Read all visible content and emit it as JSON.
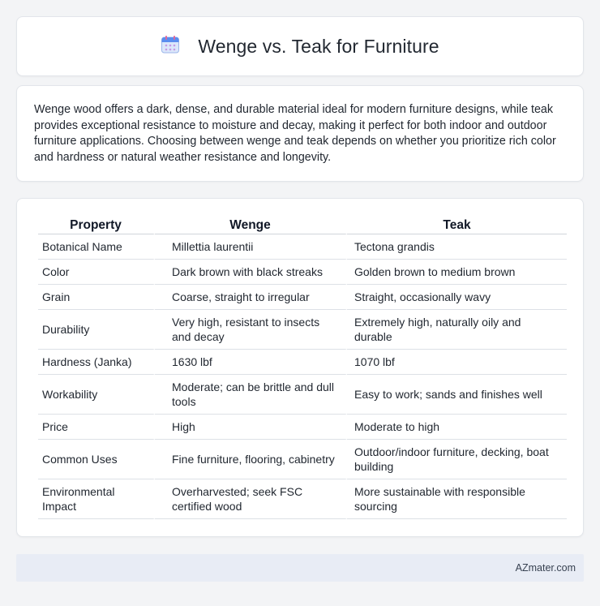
{
  "header": {
    "title": "Wenge vs. Teak for Furniture",
    "icon": "calendar-icon"
  },
  "intro": {
    "text": "Wenge wood offers a dark, dense, and durable material ideal for modern furniture designs, while teak provides exceptional resistance to moisture and decay, making it perfect for both indoor and outdoor furniture applications. Choosing between wenge and teak depends on whether you prioritize rich color and hardness or natural weather resistance and longevity."
  },
  "table": {
    "columns": [
      "Property",
      "Wenge",
      "Teak"
    ],
    "rows": [
      [
        "Botanical Name",
        "Millettia laurentii",
        "Tectona grandis"
      ],
      [
        "Color",
        "Dark brown with black streaks",
        "Golden brown to medium brown"
      ],
      [
        "Grain",
        "Coarse, straight to irregular",
        "Straight, occasionally wavy"
      ],
      [
        "Durability",
        "Very high, resistant to insects and decay",
        "Extremely high, naturally oily and durable"
      ],
      [
        "Hardness (Janka)",
        "1630 lbf",
        "1070 lbf"
      ],
      [
        "Workability",
        "Moderate; can be brittle and dull tools",
        "Easy to work; sands and finishes well"
      ],
      [
        "Price",
        "High",
        "Moderate to high"
      ],
      [
        "Common Uses",
        "Fine furniture, flooring, cabinetry",
        "Outdoor/indoor furniture, decking, boat building"
      ],
      [
        "Environmental Impact",
        "Overharvested; seek FSC certified wood",
        "More sustainable with responsible sourcing"
      ]
    ]
  },
  "footer": {
    "brand": "AZmater.com"
  }
}
